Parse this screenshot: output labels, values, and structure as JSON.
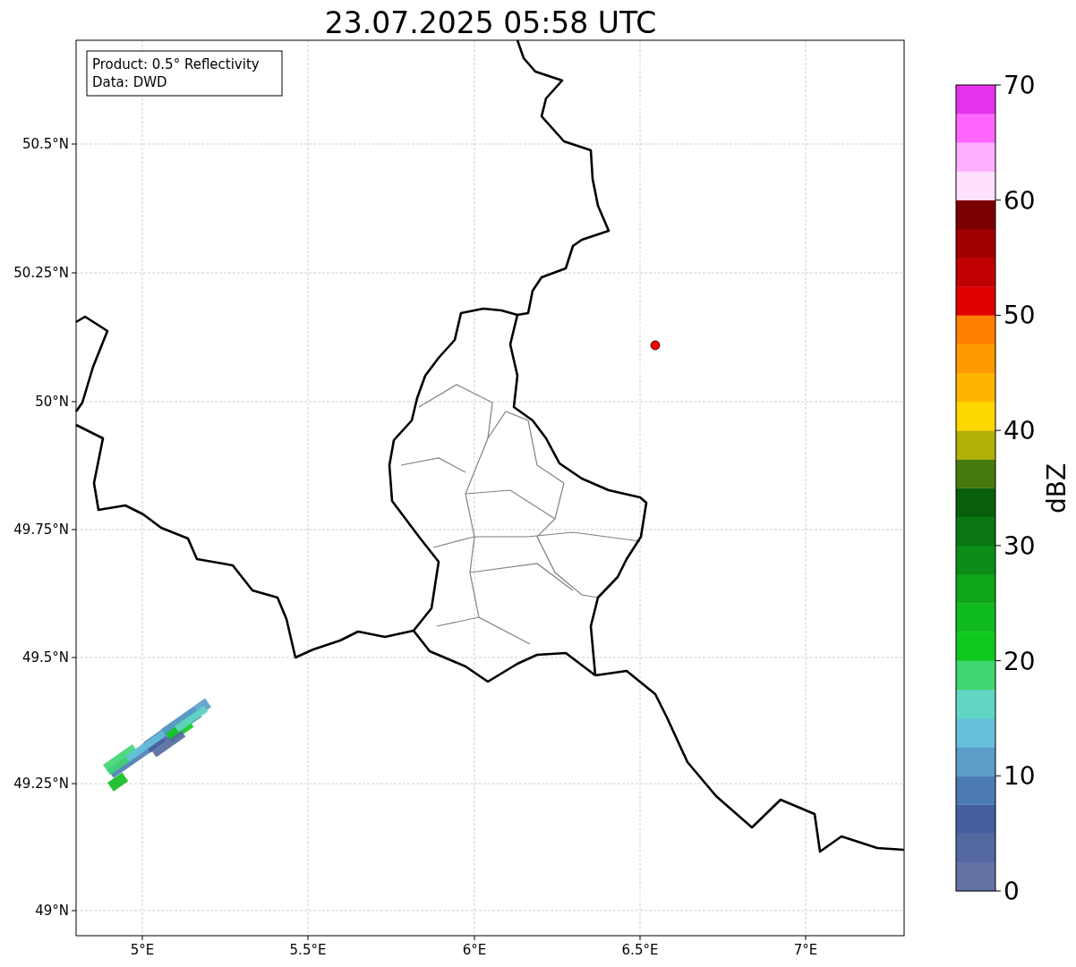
{
  "title": "23.07.2025 05:58 UTC",
  "info_box": [
    "Product: 0.5° Reflectivity",
    "Data: DWD"
  ],
  "map": {
    "x_ticks": [
      "5°E",
      "5.5°E",
      "6°E",
      "6.5°E",
      "7°E"
    ],
    "y_ticks": [
      "50.5°N",
      "50.25°N",
      "50°N",
      "49.75°N",
      "49.5°N",
      "49.25°N",
      "49°N"
    ]
  },
  "colorbar": {
    "label": "dBZ",
    "ticks": [
      "70",
      "60",
      "50",
      "40",
      "30",
      "20",
      "10",
      "0"
    ],
    "bins": [
      {
        "color": "#6473a5"
      },
      {
        "color": "#53689f"
      },
      {
        "color": "#445ea0"
      },
      {
        "color": "#4c7bb4"
      },
      {
        "color": "#5b9fc8"
      },
      {
        "color": "#66c0dc"
      },
      {
        "color": "#62d6c4"
      },
      {
        "color": "#3dd671"
      },
      {
        "color": "#10c91f"
      },
      {
        "color": "#10bb1d"
      },
      {
        "color": "#0ea618"
      },
      {
        "color": "#0b8c16"
      },
      {
        "color": "#0a7612"
      },
      {
        "color": "#075f0c"
      },
      {
        "color": "#477a0c"
      },
      {
        "color": "#b0b007"
      },
      {
        "color": "#ffd700"
      },
      {
        "color": "#ffb400"
      },
      {
        "color": "#ff9900"
      },
      {
        "color": "#ff7f00"
      },
      {
        "color": "#e00000"
      },
      {
        "color": "#c00000"
      },
      {
        "color": "#a00000"
      },
      {
        "color": "#780000"
      },
      {
        "color": "#ffe0ff"
      },
      {
        "color": "#ffb0ff"
      },
      {
        "color": "#ff66ff"
      },
      {
        "color": "#e633ee"
      }
    ]
  }
}
